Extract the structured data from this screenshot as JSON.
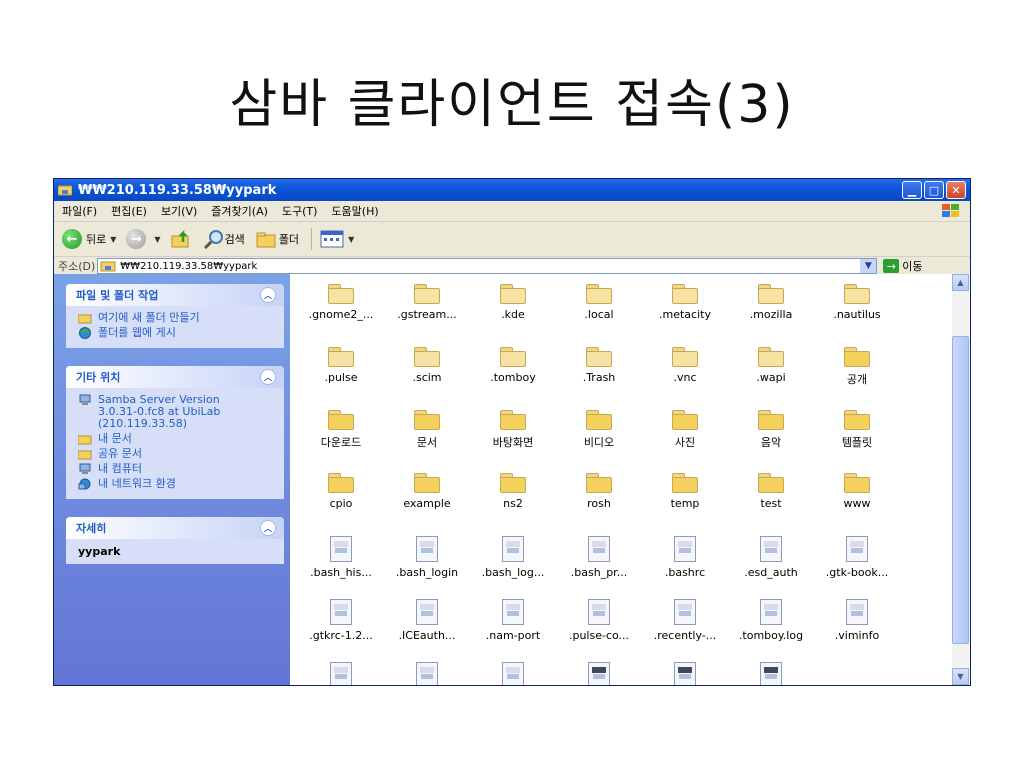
{
  "slide_title": "삼바 클라이언트 접속(3)",
  "window": {
    "title": "₩₩210.119.33.58₩yypark"
  },
  "menu": [
    "파일(F)",
    "편집(E)",
    "보기(V)",
    "즐겨찾기(A)",
    "도구(T)",
    "도움말(H)"
  ],
  "toolbar": {
    "back": "뒤로",
    "search": "검색",
    "folders": "폴더"
  },
  "address": {
    "label": "주소(D)",
    "value": "₩₩210.119.33.58₩yypark",
    "go": "이동"
  },
  "left_panels": {
    "tasks": {
      "title": "파일 및 폴더 작업",
      "items": [
        "여기에 새 폴더 만들기",
        "폴더를 웹에 게시"
      ]
    },
    "places": {
      "title": "기타 위치",
      "items": [
        "Samba Server Version 3.0.31-0.fc8 at UbiLab (210.119.33.58)",
        "내 문서",
        "공유 문서",
        "내 컴퓨터",
        "내 네트워크 환경"
      ]
    },
    "details": {
      "title": "자세히",
      "name": "yypark"
    }
  },
  "files": [
    [
      ".gnome2_...",
      ".gstream...",
      ".kde",
      ".local",
      ".metacity",
      ".mozilla",
      ".nautilus"
    ],
    [
      ".pulse",
      ".scim",
      ".tomboy",
      ".Trash",
      ".vnc",
      ".wapi",
      "공개"
    ],
    [
      "다운로드",
      "문서",
      "바탕화면",
      "비디오",
      "사진",
      "음악",
      "템플릿"
    ],
    [
      "cpio",
      "example",
      "ns2",
      "rosh",
      "temp",
      "test",
      "www"
    ],
    [
      ".bash_his...",
      ".bash_login",
      ".bash_log...",
      ".bash_pr...",
      ".bashrc",
      ".esd_auth",
      ".gtk-book..."
    ],
    [
      ".gtkrc-1.2...",
      ".ICEauth...",
      ".nam-port",
      ".pulse-co...",
      ".recently-...",
      ".tomboy.log",
      ".viminfo"
    ]
  ]
}
